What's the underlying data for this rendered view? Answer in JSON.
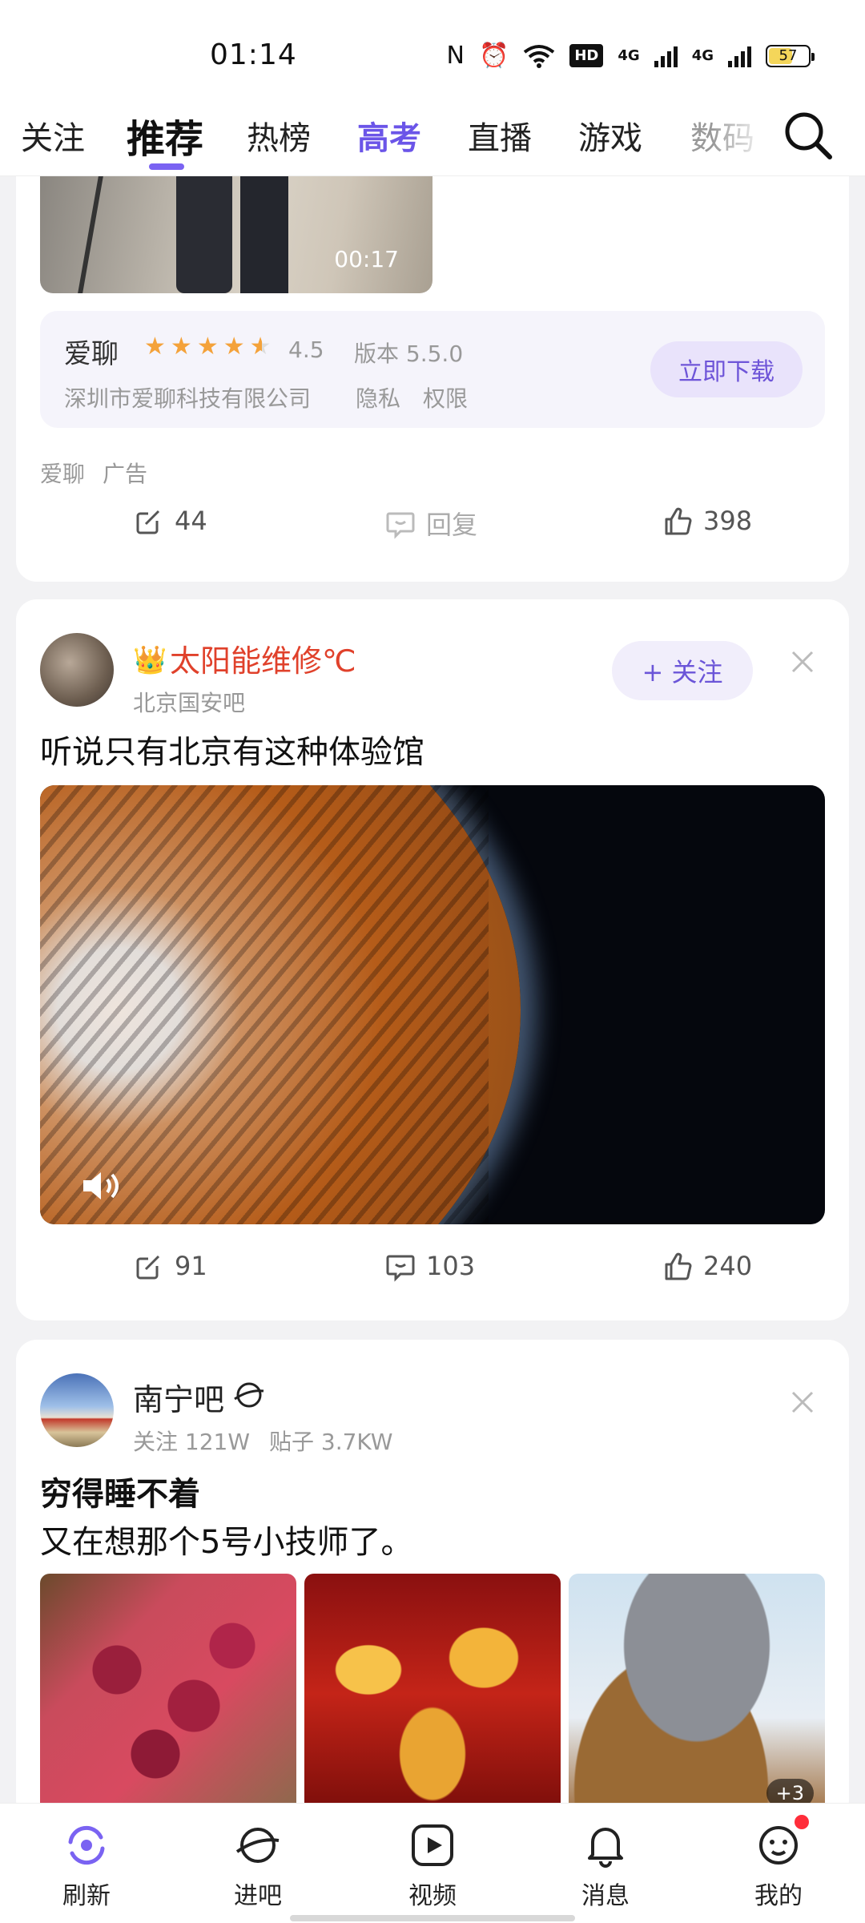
{
  "status_bar": {
    "time": "01:14",
    "network_hd": "HD",
    "network_1": "4G",
    "network_2": "4G",
    "battery": "57"
  },
  "tabs": [
    {
      "label": "关注"
    },
    {
      "label": "推荐"
    },
    {
      "label": "热榜"
    },
    {
      "label": "高考"
    },
    {
      "label": "直播"
    },
    {
      "label": "游戏"
    },
    {
      "label": "数码"
    }
  ],
  "ad_card": {
    "video_duration": "00:17",
    "app_name": "爱聊",
    "rating": "4.5",
    "version": "版本 5.5.0",
    "company": "深圳市爱聊科技有限公司",
    "privacy": "隐私",
    "permissions": "权限",
    "download_label": "立即下载",
    "source": "爱聊",
    "ad_tag": "广告",
    "shares": "44",
    "reply_label": "回复",
    "likes": "398"
  },
  "post1": {
    "username": "太阳能维修℃",
    "forum": "北京国安吧",
    "follow_label": "+ 关注",
    "title": "听说只有北京有这种体验馆",
    "shares": "91",
    "comments": "103",
    "likes": "240"
  },
  "post2": {
    "forum_name": "南宁吧",
    "followers": "关注 121W",
    "posts": "贴子 3.7KW",
    "title": "穷得睡不着",
    "body": "又在想那个5号小技师了。",
    "more_images": "+3"
  },
  "bottom_nav": [
    {
      "label": "刷新",
      "icon": "refresh-icon"
    },
    {
      "label": "进吧",
      "icon": "planet-icon"
    },
    {
      "label": "视频",
      "icon": "video-icon"
    },
    {
      "label": "消息",
      "icon": "bell-icon"
    },
    {
      "label": "我的",
      "icon": "smiley-icon"
    }
  ],
  "colors": {
    "accent": "#7a63f2",
    "username_red": "#e0412b",
    "star": "#f4a23a"
  }
}
